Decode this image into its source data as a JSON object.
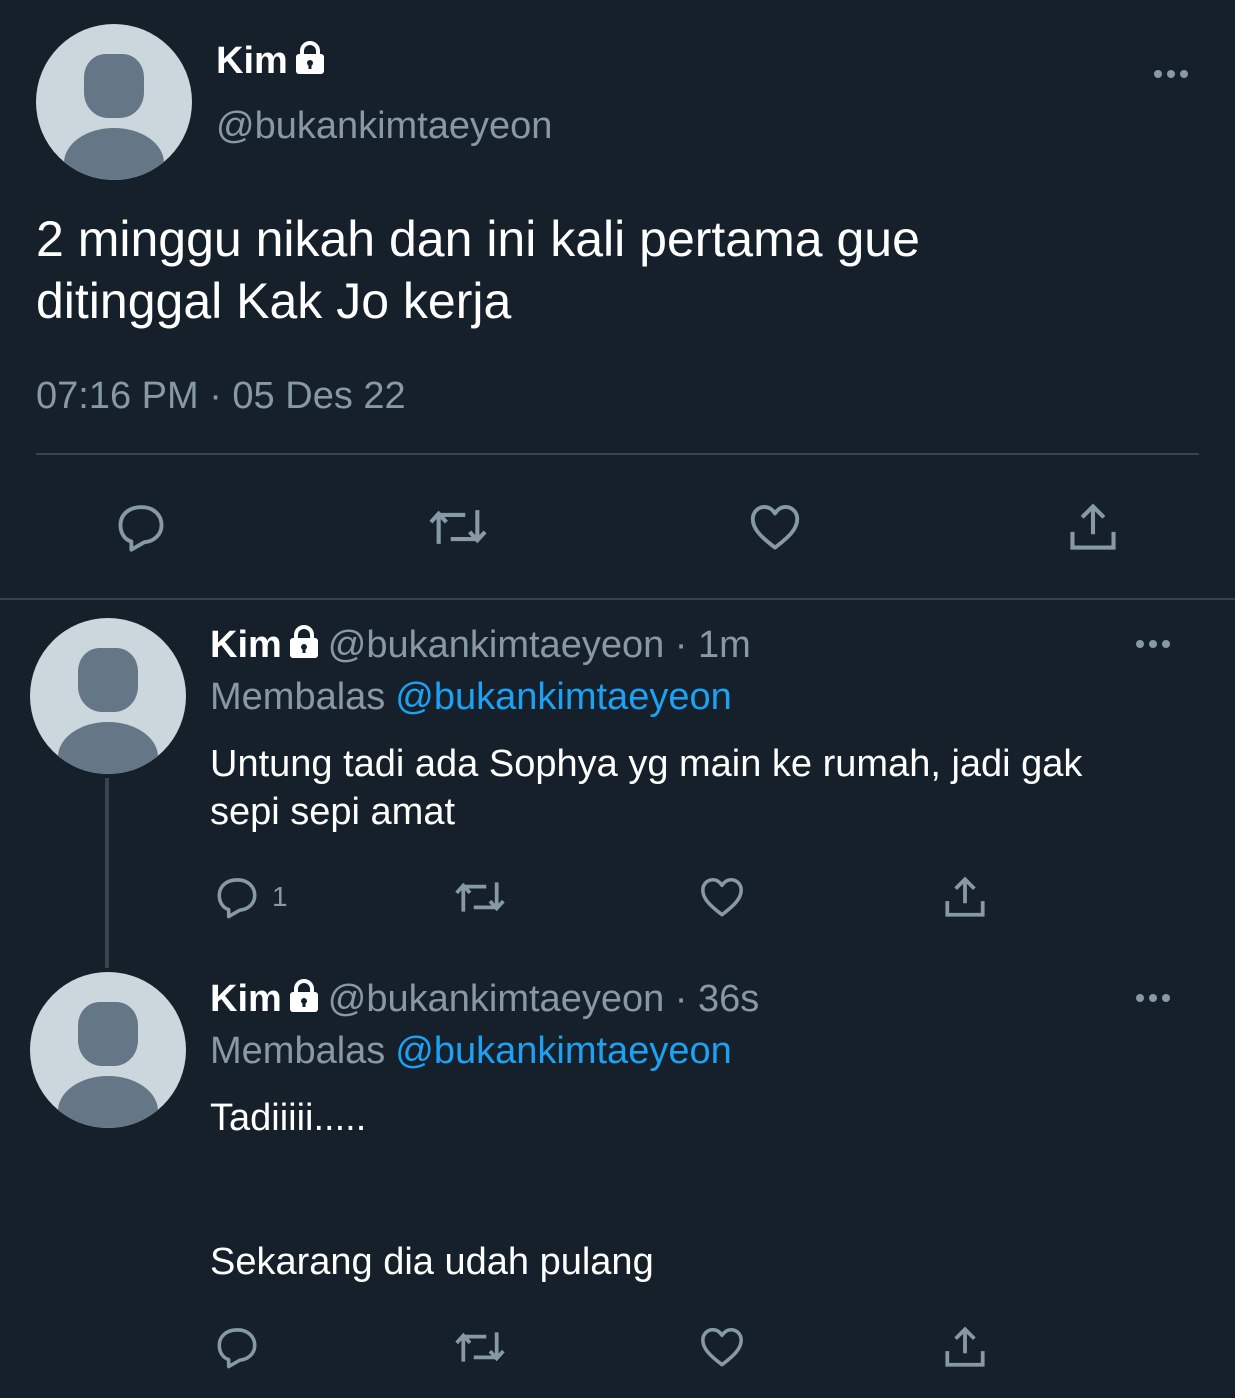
{
  "main_tweet": {
    "author_name": "Kim",
    "handle": "@bukankimtaeyeon",
    "text_line1": "2 minggu nikah dan ini kali pertama gue",
    "text_line2": "ditinggal Kak Jo kerja",
    "timestamp": "07:16 PM · 05 Des 22",
    "icons": {
      "lock": "lock-icon",
      "more": "more-icon",
      "reply": "reply-icon",
      "retweet": "retweet-icon",
      "like": "heart-icon",
      "share": "share-icon"
    }
  },
  "replies": [
    {
      "author_name": "Kim",
      "meta": "@bukankimtaeyeon · 1m",
      "replying_label": "Membalas",
      "replying_to": "@bukankimtaeyeon",
      "text_line1": "Untung tadi ada Sophya yg main ke rumah, jadi gak",
      "text_line2": "sepi sepi amat",
      "reply_count": "1"
    },
    {
      "author_name": "Kim",
      "meta": "@bukankimtaeyeon · 36s",
      "replying_label": "Membalas",
      "replying_to": "@bukankimtaeyeon",
      "text_line1": "Tadiiiii.....",
      "text_line2": "Sekarang dia udah pulang",
      "reply_count": ""
    }
  ],
  "colors": {
    "background": "#15202b",
    "secondary_text": "#8899a6",
    "mention": "#1da1f2",
    "divider": "#38444d",
    "avatar_bg": "#ccd6dd",
    "avatar_fg": "#657786"
  }
}
